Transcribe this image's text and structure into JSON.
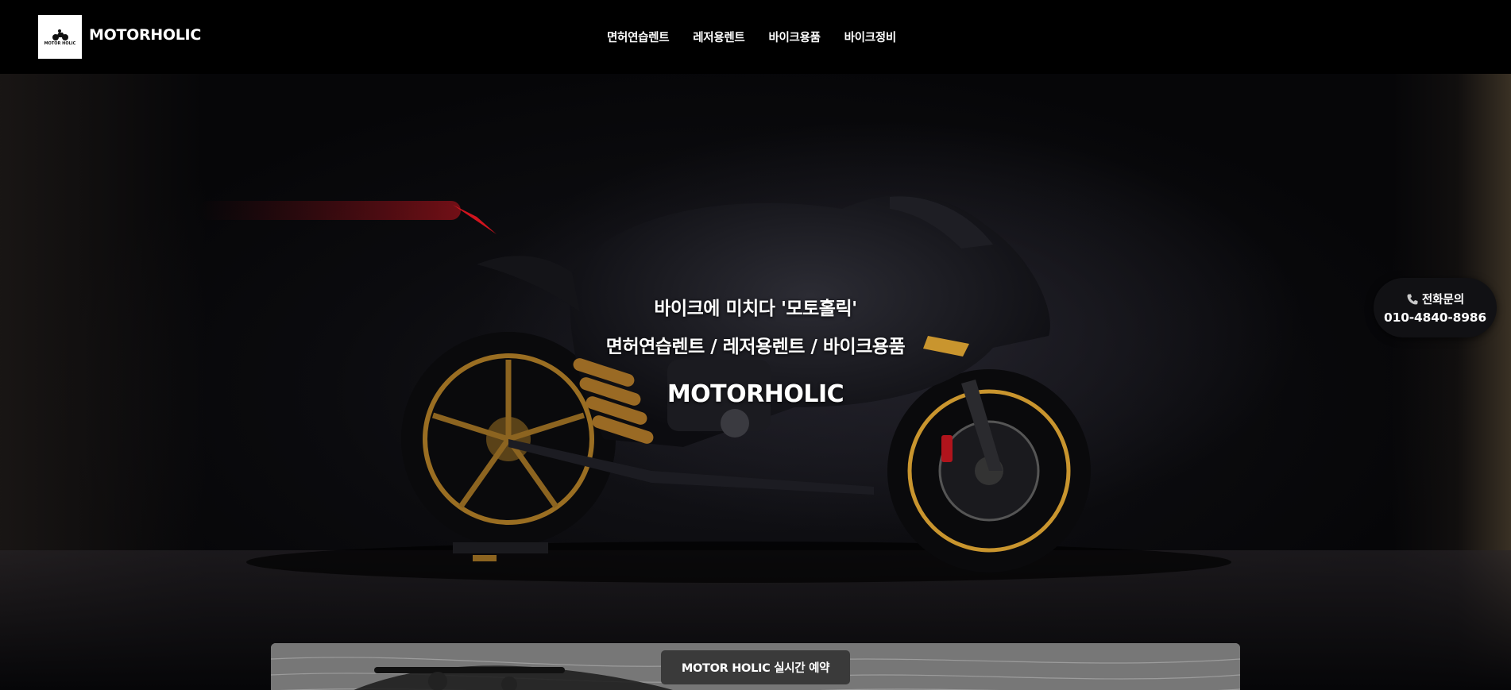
{
  "header": {
    "logo_alt": "motorcycle-logo",
    "logo_small_text": "MOTOR HOLIC",
    "brand": "MOTORHOLIC",
    "nav": [
      {
        "label": "면허연습렌트"
      },
      {
        "label": "레저용렌트"
      },
      {
        "label": "바이크용품"
      },
      {
        "label": "바이크정비"
      }
    ]
  },
  "hero": {
    "tagline": "바이크에 미치다 '모토홀릭'",
    "services": "면허연습렌트 / 레저용렌트 / 바이크용품",
    "title": "MOTORHOLIC"
  },
  "phone": {
    "icon": "phone-icon",
    "label": "전화문의",
    "number": "010-4840-8986"
  },
  "reservation": {
    "button_label": "MOTOR HOLIC 실시간 예약"
  },
  "colors": {
    "header_bg": "#000000",
    "hero_bg": "#0b0b0e",
    "accent_gold": "#c9952e",
    "accent_red": "#d0141e",
    "button_bg": "#3a3a3a"
  }
}
